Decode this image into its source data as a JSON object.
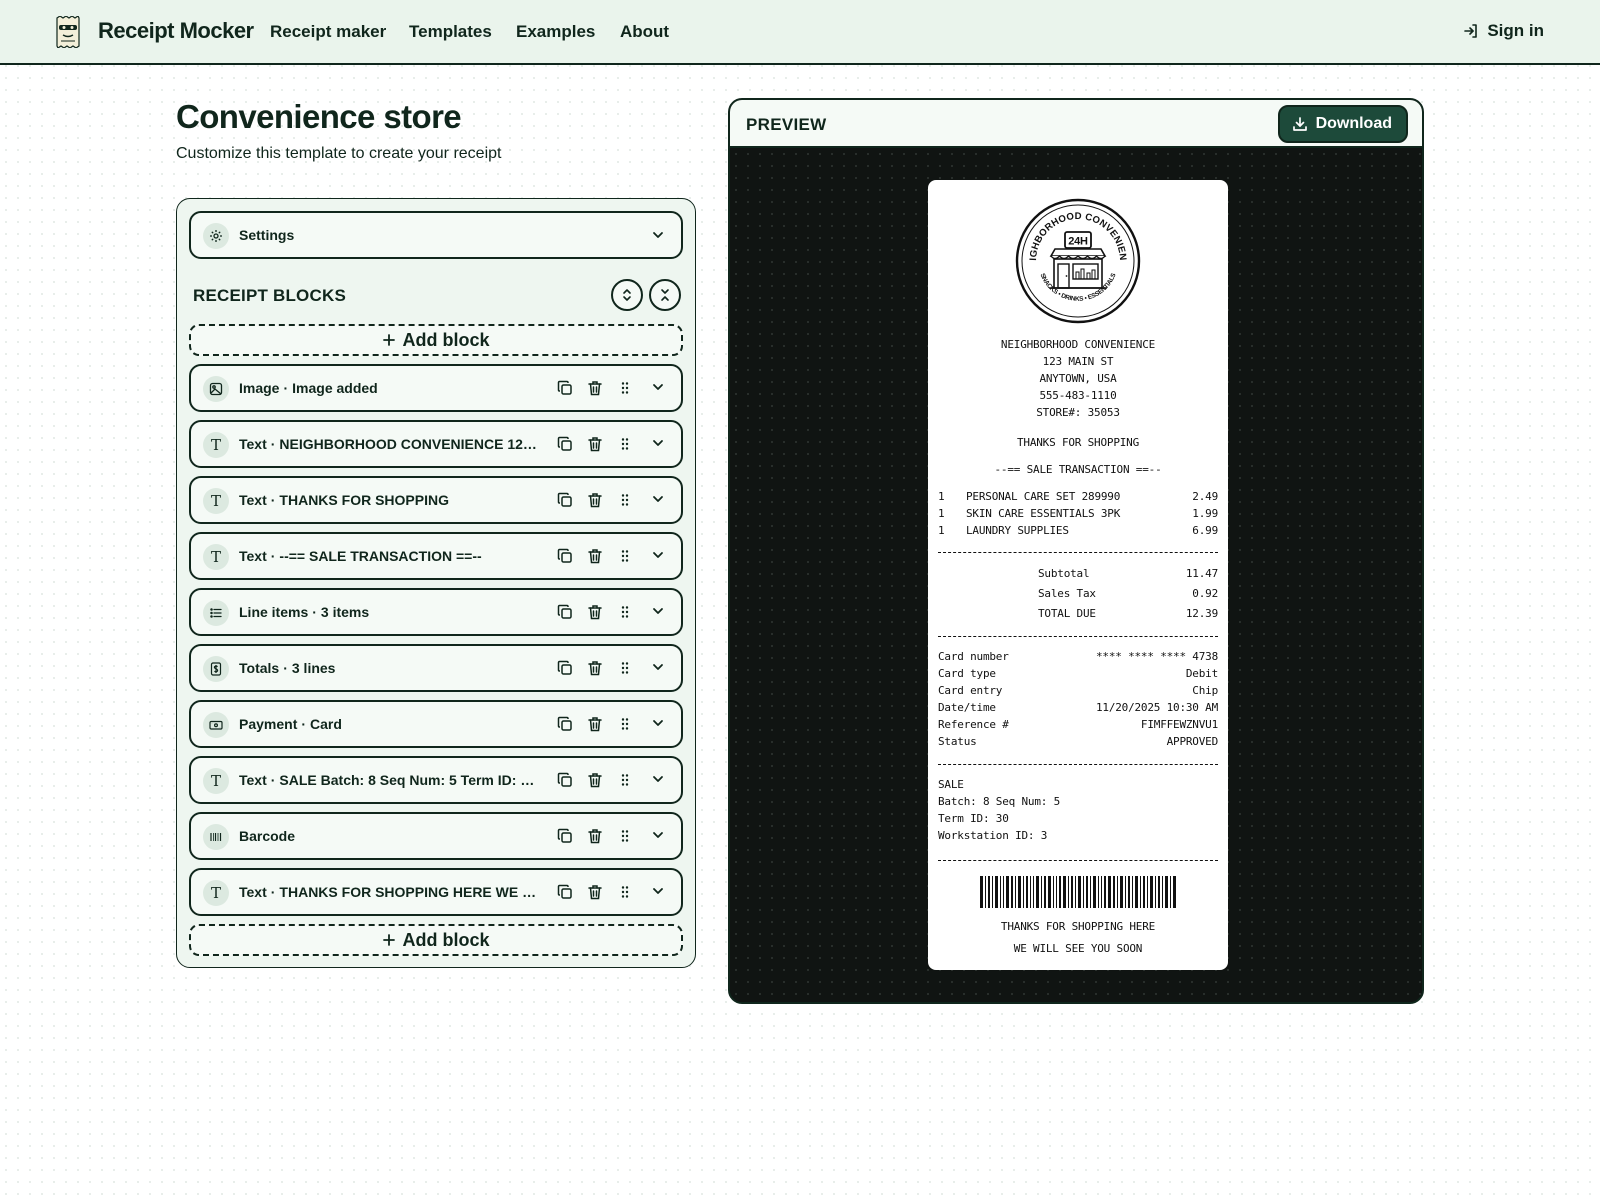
{
  "header": {
    "brand": "Receipt Mocker",
    "nav": [
      "Receipt maker",
      "Templates",
      "Examples",
      "About"
    ],
    "sign_in": "Sign in"
  },
  "page": {
    "title": "Convenience store",
    "subtitle": "Customize this template to create your receipt"
  },
  "editor": {
    "settings_label": "Settings",
    "blocks_title": "RECEIPT BLOCKS",
    "add_block": "Add block",
    "blocks": [
      {
        "type": "Image",
        "summary": "Image added",
        "icon": "image-icon"
      },
      {
        "type": "Text",
        "summary": "NEIGHBORHOOD CONVENIENCE 123 MAIN ST ANYTOWN, USA 555-483-1110 STORE#: 35053",
        "icon": "text-icon"
      },
      {
        "type": "Text",
        "summary": "THANKS FOR SHOPPING",
        "icon": "text-icon"
      },
      {
        "type": "Text",
        "summary": "--== SALE TRANSACTION ==--",
        "icon": "text-icon"
      },
      {
        "type": "Line items",
        "summary": "3 items",
        "icon": "list-icon"
      },
      {
        "type": "Totals",
        "summary": "3 lines",
        "icon": "dollar-icon"
      },
      {
        "type": "Payment",
        "summary": "Card",
        "icon": "card-icon"
      },
      {
        "type": "Text",
        "summary": "SALE Batch: 8 Seq Num: 5 Term ID: 30 Workstation ID: 3",
        "icon": "text-icon"
      },
      {
        "type": "Barcode",
        "summary": "",
        "icon": "barcode-icon"
      },
      {
        "type": "Text",
        "summary": "THANKS FOR SHOPPING HERE WE WILL SEE YOU SOON",
        "icon": "text-icon"
      }
    ]
  },
  "preview": {
    "label": "PREVIEW",
    "download": "Download"
  },
  "receipt": {
    "logo": {
      "ring_text": "NEIGHBORHOOD CONVENIENCE",
      "badge": "24H",
      "bottom_text": "SNACKS • DRINKS • ESSENTIALS"
    },
    "header_lines": [
      "NEIGHBORHOOD CONVENIENCE",
      "123 MAIN ST",
      "ANYTOWN, USA",
      "555-483-1110",
      "STORE#: 35053"
    ],
    "thanks": "THANKS FOR SHOPPING",
    "transaction": "--== SALE TRANSACTION ==--",
    "items": [
      {
        "qty": "1",
        "name": "PERSONAL CARE SET 289990",
        "price": "2.49"
      },
      {
        "qty": "1",
        "name": "SKIN CARE ESSENTIALS 3PK",
        "price": "1.99"
      },
      {
        "qty": "1",
        "name": "LAUNDRY SUPPLIES",
        "price": "6.99"
      }
    ],
    "totals": [
      {
        "label": "Subtotal",
        "value": "11.47"
      },
      {
        "label": "Sales Tax",
        "value": "0.92"
      },
      {
        "label": "TOTAL DUE",
        "value": "12.39"
      }
    ],
    "payment": [
      {
        "label": "Card number",
        "value": "**** **** **** 4738"
      },
      {
        "label": "Card type",
        "value": "Debit"
      },
      {
        "label": "Card entry",
        "value": "Chip"
      },
      {
        "label": "Date/time",
        "value": "11/20/2025 10:30 AM"
      },
      {
        "label": "Reference #",
        "value": "FIMFFEWZNVU1"
      },
      {
        "label": "Status",
        "value": "APPROVED"
      }
    ],
    "sale_lines": [
      "SALE",
      "Batch: 8 Seq Num: 5",
      "Term ID: 30",
      "Workstation ID: 3"
    ],
    "footer_lines": [
      "THANKS FOR SHOPPING HERE",
      "WE WILL SEE YOU SOON"
    ]
  },
  "colors": {
    "header_bg": "#eaf4ec",
    "ink": "#10261c",
    "accent": "#1d4a3a",
    "panel_bg": "#eef6f0",
    "preview_bg": "#101412"
  }
}
